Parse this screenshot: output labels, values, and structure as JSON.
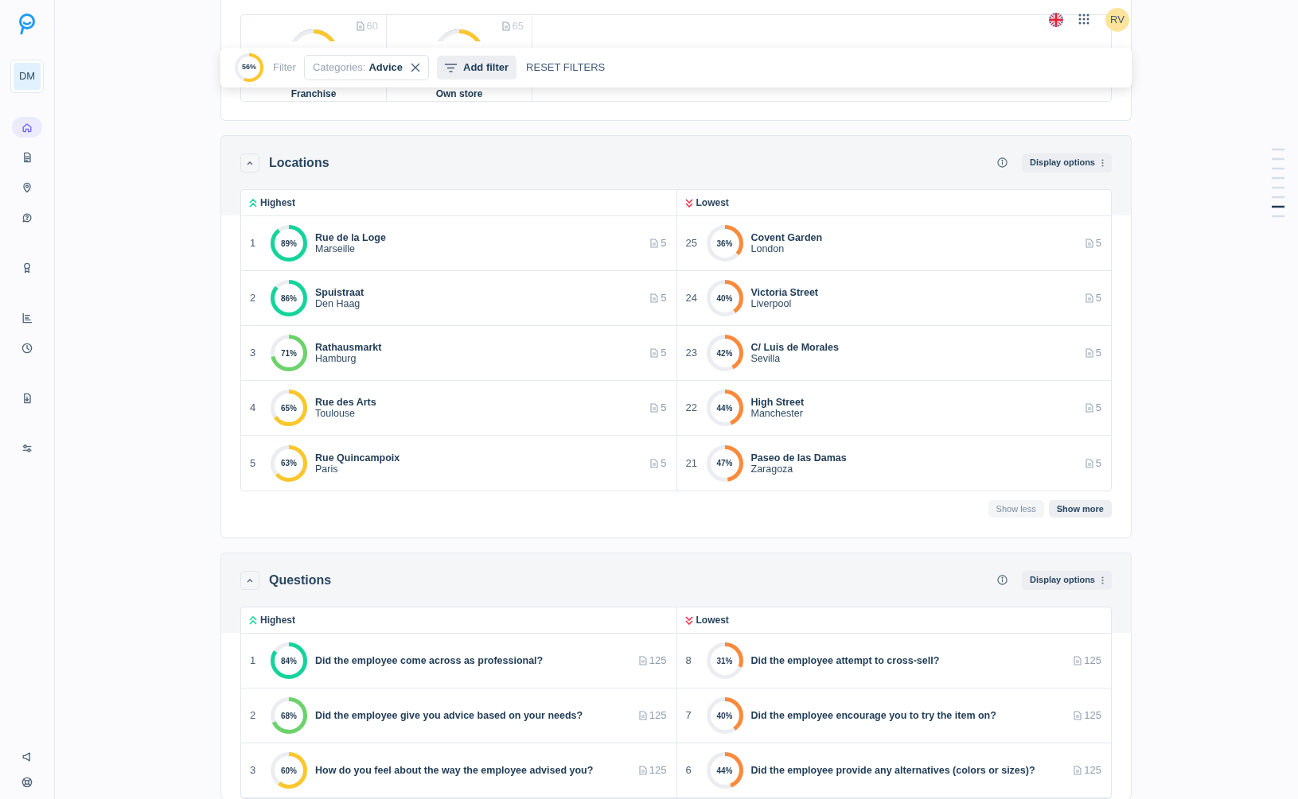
{
  "sidebar": {
    "workspace": "DM",
    "items": [
      {
        "selected": true
      },
      {
        "selected": false
      },
      {
        "selected": false
      },
      {
        "selected": false
      },
      {
        "selected": false
      },
      {
        "selected": false
      },
      {
        "selected": false
      },
      {
        "selected": false
      },
      {
        "selected": false
      }
    ],
    "footer_items": [
      {
        "selected": false
      },
      {
        "selected": false
      }
    ]
  },
  "top_bar": {
    "avatar": "RV"
  },
  "overview": [
    {
      "count": "60",
      "label": "Franchise"
    },
    {
      "count": "65",
      "label": "Own store"
    }
  ],
  "filter_bar": {
    "score": "56%",
    "level": 0.56,
    "color": "#fcc72c",
    "label": "Filter",
    "chip": {
      "key": "Categories:",
      "value": "Advice"
    },
    "add_filter": "Add filter",
    "reset": "RESET FILTERS"
  },
  "sections": [
    {
      "title": "Locations",
      "expanded": true,
      "display_options": "Display options",
      "highest_label": "Highest",
      "lowest_label": "Lowest",
      "highest": [
        {
          "rank": "1",
          "score": "89%",
          "level": 0.89,
          "color": "#13d49b",
          "title": "Rue de la Loge",
          "subtitle": "Marseille",
          "count": "5"
        },
        {
          "rank": "2",
          "score": "86%",
          "level": 0.86,
          "color": "#13d49b",
          "title": "Spuistraat",
          "subtitle": "Den Haag",
          "count": "5"
        },
        {
          "rank": "3",
          "score": "71%",
          "level": 0.71,
          "color": "#6cd26a",
          "title": "Rathausmarkt",
          "subtitle": "Hamburg",
          "count": "5"
        },
        {
          "rank": "4",
          "score": "65%",
          "level": 0.65,
          "color": "#fcc72c",
          "title": "Rue des Arts",
          "subtitle": "Toulouse",
          "count": "5"
        },
        {
          "rank": "5",
          "score": "63%",
          "level": 0.63,
          "color": "#fcc72c",
          "title": "Rue Quincampoix",
          "subtitle": "Paris",
          "count": "5"
        }
      ],
      "lowest": [
        {
          "rank": "25",
          "score": "36%",
          "level": 0.36,
          "color": "#fb8a3c",
          "title": "Covent Garden",
          "subtitle": "London",
          "count": "5"
        },
        {
          "rank": "24",
          "score": "40%",
          "level": 0.4,
          "color": "#fb8a3c",
          "title": "Victoria Street",
          "subtitle": "Liverpool",
          "count": "5"
        },
        {
          "rank": "23",
          "score": "42%",
          "level": 0.42,
          "color": "#fb8a3c",
          "title": "C/ Luis de Morales",
          "subtitle": "Sevilla",
          "count": "5"
        },
        {
          "rank": "22",
          "score": "44%",
          "level": 0.44,
          "color": "#fb8a3c",
          "title": "High Street",
          "subtitle": "Manchester",
          "count": "5"
        },
        {
          "rank": "21",
          "score": "47%",
          "level": 0.47,
          "color": "#fb8a3c",
          "title": "Paseo de las Damas",
          "subtitle": "Zaragoza",
          "count": "5"
        }
      ],
      "buttons": [
        "Show less",
        "Show more"
      ]
    },
    {
      "title": "Questions",
      "expanded": true,
      "display_options": "Display options",
      "highest_label": "Highest",
      "lowest_label": "Lowest",
      "highest": [
        {
          "rank": "1",
          "score": "84%",
          "level": 0.84,
          "color": "#13d49b",
          "title": "Did the employee come across as professional?",
          "count": "125"
        },
        {
          "rank": "2",
          "score": "68%",
          "level": 0.68,
          "color": "#6cd26a",
          "title": "Did the employee give you advice based on your needs?",
          "count": "125"
        },
        {
          "rank": "3",
          "score": "60%",
          "level": 0.6,
          "color": "#fcc72c",
          "title": "How do you feel about the way the employee advised you?",
          "count": "125"
        }
      ],
      "lowest": [
        {
          "rank": "8",
          "score": "31%",
          "level": 0.31,
          "color": "#fb8a3c",
          "title": "Did the employee attempt to cross-sell?",
          "count": "125"
        },
        {
          "rank": "7",
          "score": "40%",
          "level": 0.4,
          "color": "#fb8a3c",
          "title": "Did the employee encourage you to try the item on?",
          "count": "125"
        },
        {
          "rank": "6",
          "score": "44%",
          "level": 0.44,
          "color": "#fb8a3c",
          "title": "Did the employee provide any alternatives (colors or sizes)?",
          "count": "125"
        }
      ]
    }
  ]
}
